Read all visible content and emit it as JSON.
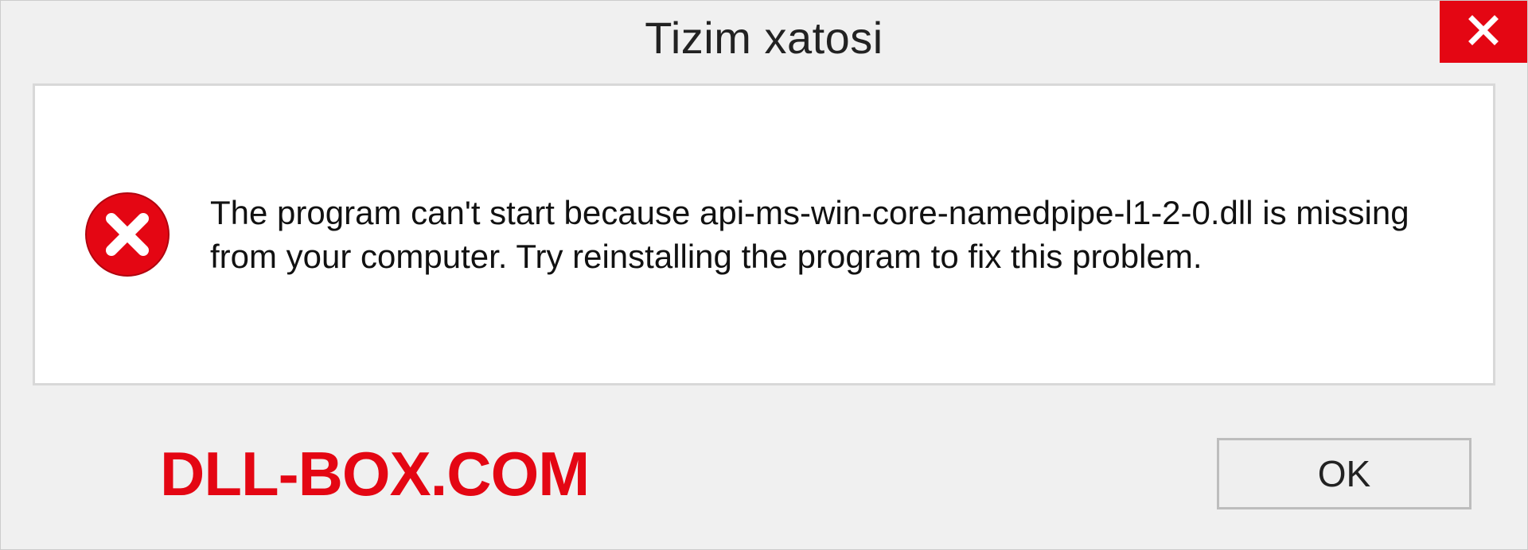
{
  "dialog": {
    "title": "Tizim xatosi",
    "message": "The program can't start because api-ms-win-core-namedpipe-l1-2-0.dll is missing from your computer. Try reinstalling the program to fix this problem.",
    "ok_label": "OK"
  },
  "brand": "DLL-BOX.COM",
  "colors": {
    "accent": "#e40613"
  },
  "icons": {
    "close": "close-icon",
    "error": "error-circle-x-icon"
  }
}
